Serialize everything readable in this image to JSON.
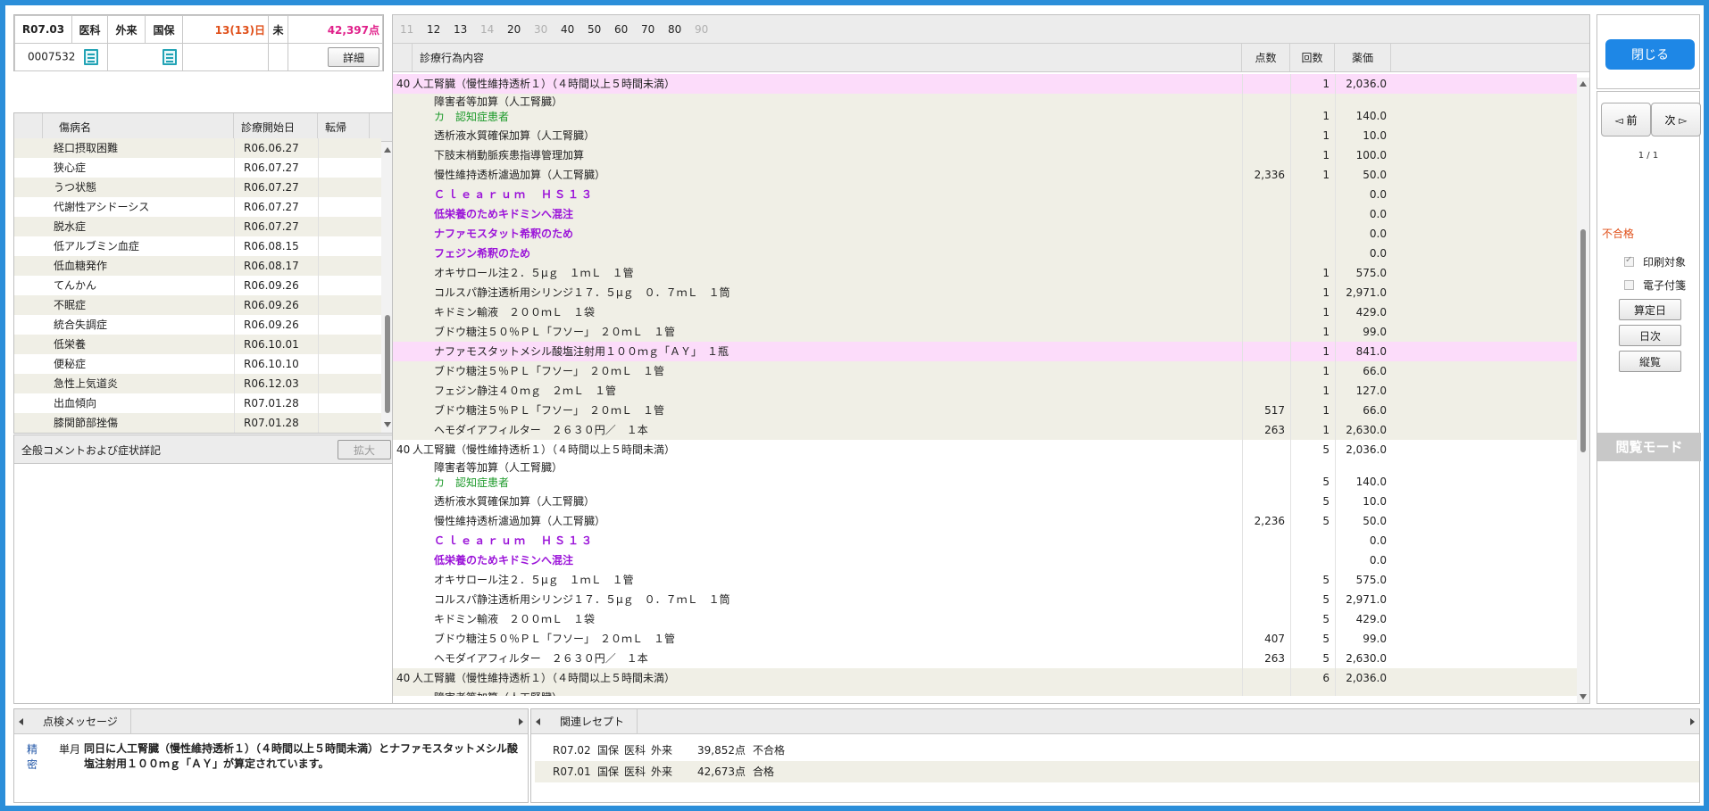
{
  "info": {
    "year_month": "R07.03",
    "dept": "医科",
    "io": "外来",
    "insurance": "国保",
    "days": "13(13)日",
    "status": "未",
    "points": "42,397点",
    "patient_id": "0007532",
    "detail_button": "詳細"
  },
  "disease": {
    "col_name": "傷病名",
    "col_start": "診療開始日",
    "col_outcome": "転帰",
    "rows": [
      {
        "name": "経口摂取困難",
        "date": "R06.06.27"
      },
      {
        "name": "狭心症",
        "date": "R06.07.27"
      },
      {
        "name": "うつ状態",
        "date": "R06.07.27"
      },
      {
        "name": "代謝性アシドーシス",
        "date": "R06.07.27"
      },
      {
        "name": "脱水症",
        "date": "R06.07.27"
      },
      {
        "name": "低アルブミン血症",
        "date": "R06.08.15"
      },
      {
        "name": "低血糖発作",
        "date": "R06.08.17"
      },
      {
        "name": "てんかん",
        "date": "R06.09.26"
      },
      {
        "name": "不眠症",
        "date": "R06.09.26"
      },
      {
        "name": "統合失調症",
        "date": "R06.09.26"
      },
      {
        "name": "低栄養",
        "date": "R06.10.01"
      },
      {
        "name": "便秘症",
        "date": "R06.10.10"
      },
      {
        "name": "急性上気道炎",
        "date": "R06.12.03"
      },
      {
        "name": "出血傾向",
        "date": "R07.01.28"
      },
      {
        "name": "膝関節部挫傷",
        "date": "R07.01.28"
      }
    ]
  },
  "comment": {
    "title": "全般コメントおよび症状詳記",
    "expand_button": "拡大"
  },
  "tabs": [
    {
      "label": "11",
      "dim": true
    },
    {
      "label": "12",
      "dim": false
    },
    {
      "label": "13",
      "dim": false
    },
    {
      "label": "14",
      "dim": true
    },
    {
      "label": "20",
      "dim": false
    },
    {
      "label": "30",
      "dim": true
    },
    {
      "label": "40",
      "dim": false
    },
    {
      "label": "50",
      "dim": false
    },
    {
      "label": "60",
      "dim": false
    },
    {
      "label": "70",
      "dim": false
    },
    {
      "label": "80",
      "dim": false
    },
    {
      "label": "90",
      "dim": true
    }
  ],
  "main": {
    "col_content": "診療行為内容",
    "col_points": "点数",
    "col_count": "回数",
    "col_price": "薬価",
    "rows": [
      {
        "k": "40",
        "name": "人工腎臓（慢性維持透析１）（４時間以上５時間未満）",
        "p": "",
        "c": "1",
        "y": "2,036.0",
        "bg": "pink"
      },
      {
        "k": "",
        "name": "障害者等加算（人工腎臓）",
        "name2": "カ　認知症患者",
        "p": "",
        "c": "1",
        "y": "140.0",
        "bg": "alt",
        "two": true
      },
      {
        "k": "",
        "name": "透析液水質確保加算（人工腎臓）",
        "p": "",
        "c": "1",
        "y": "10.0",
        "bg": "alt"
      },
      {
        "k": "",
        "name": "下肢末梢動脈疾患指導管理加算",
        "p": "",
        "c": "1",
        "y": "100.0",
        "bg": "alt"
      },
      {
        "k": "",
        "name": "慢性維持透析濾過加算（人工腎臓）",
        "p": "2,336",
        "c": "1",
        "y": "50.0",
        "bg": "alt"
      },
      {
        "k": "",
        "name": "Ｃｌｅａｒｕｍ　ＨＳ１３",
        "p": "",
        "c": "",
        "y": "0.0",
        "bg": "alt",
        "style": "purple-sp"
      },
      {
        "k": "",
        "name": "低栄養のためキドミンへ混注",
        "p": "",
        "c": "",
        "y": "0.0",
        "bg": "alt",
        "style": "purple"
      },
      {
        "k": "",
        "name": "ナファモスタット希釈のため",
        "p": "",
        "c": "",
        "y": "0.0",
        "bg": "alt",
        "style": "purple"
      },
      {
        "k": "",
        "name": "フェジン希釈のため",
        "p": "",
        "c": "",
        "y": "0.0",
        "bg": "alt",
        "style": "purple"
      },
      {
        "k": "",
        "name": "オキサロール注２．５μｇ　１ｍＬ　１管",
        "p": "",
        "c": "1",
        "y": "575.0",
        "bg": "alt"
      },
      {
        "k": "",
        "name": "コルスパ静注透析用シリンジ１７．５μｇ　０．７ｍＬ　１筒",
        "p": "",
        "c": "1",
        "y": "2,971.0",
        "bg": "alt"
      },
      {
        "k": "",
        "name": "キドミン輸液　２００ｍＬ　１袋",
        "p": "",
        "c": "1",
        "y": "429.0",
        "bg": "alt"
      },
      {
        "k": "",
        "name": "ブドウ糖注５０％ＰＬ「フソー」　２０ｍＬ　１管",
        "p": "",
        "c": "1",
        "y": "99.0",
        "bg": "alt"
      },
      {
        "k": "",
        "name": "ナファモスタットメシル酸塩注射用１００ｍｇ「ＡＹ」　１瓶",
        "p": "",
        "c": "1",
        "y": "841.0",
        "bg": "pink"
      },
      {
        "k": "",
        "name": "ブドウ糖注５％ＰＬ「フソー」　２０ｍＬ　１管",
        "p": "",
        "c": "1",
        "y": "66.0",
        "bg": "alt"
      },
      {
        "k": "",
        "name": "フェジン静注４０ｍｇ　２ｍＬ　１管",
        "p": "",
        "c": "1",
        "y": "127.0",
        "bg": "alt"
      },
      {
        "k": "",
        "name": "ブドウ糖注５％ＰＬ「フソー」　２０ｍＬ　１管",
        "p": "517",
        "c": "1",
        "y": "66.0",
        "bg": "alt"
      },
      {
        "k": "",
        "name": "ヘモダイアフィルター　２６３０円／　１本",
        "p": "263",
        "c": "1",
        "y": "2,630.0",
        "bg": "alt"
      },
      {
        "k": "40",
        "name": "人工腎臓（慢性維持透析１）（４時間以上５時間未満）",
        "p": "",
        "c": "5",
        "y": "2,036.0",
        "bg": "white"
      },
      {
        "k": "",
        "name": "障害者等加算（人工腎臓）",
        "name2": "カ　認知症患者",
        "p": "",
        "c": "5",
        "y": "140.0",
        "bg": "white",
        "two": true
      },
      {
        "k": "",
        "name": "透析液水質確保加算（人工腎臓）",
        "p": "",
        "c": "5",
        "y": "10.0",
        "bg": "white"
      },
      {
        "k": "",
        "name": "慢性維持透析濾過加算（人工腎臓）",
        "p": "2,236",
        "c": "5",
        "y": "50.0",
        "bg": "white"
      },
      {
        "k": "",
        "name": "Ｃｌｅａｒｕｍ　ＨＳ１３",
        "p": "",
        "c": "",
        "y": "0.0",
        "bg": "white",
        "style": "purple-sp"
      },
      {
        "k": "",
        "name": "低栄養のためキドミンへ混注",
        "p": "",
        "c": "",
        "y": "0.0",
        "bg": "white",
        "style": "purple"
      },
      {
        "k": "",
        "name": "オキサロール注２．５μｇ　１ｍＬ　１管",
        "p": "",
        "c": "5",
        "y": "575.0",
        "bg": "white"
      },
      {
        "k": "",
        "name": "コルスパ静注透析用シリンジ１７．５μｇ　０．７ｍＬ　１筒",
        "p": "",
        "c": "5",
        "y": "2,971.0",
        "bg": "white"
      },
      {
        "k": "",
        "name": "キドミン輸液　２００ｍＬ　１袋",
        "p": "",
        "c": "5",
        "y": "429.0",
        "bg": "white"
      },
      {
        "k": "",
        "name": "ブドウ糖注５０％ＰＬ「フソー」　２０ｍＬ　１管",
        "p": "407",
        "c": "5",
        "y": "99.0",
        "bg": "white"
      },
      {
        "k": "",
        "name": "ヘモダイアフィルター　２６３０円／　１本",
        "p": "263",
        "c": "5",
        "y": "2,630.0",
        "bg": "white"
      },
      {
        "k": "40",
        "name": "人工腎臓（慢性維持透析１）（４時間以上５時間未満）",
        "p": "",
        "c": "6",
        "y": "2,036.0",
        "bg": "alt"
      },
      {
        "k": "",
        "name": "障害者等加算（人工腎臓）",
        "p": "",
        "c": "",
        "y": "",
        "bg": "alt"
      }
    ]
  },
  "right": {
    "close_button": "閉じる",
    "prev_button": "前",
    "next_button": "次",
    "page": "1 / 1",
    "fail_label": "不合格",
    "print_target": "印刷対象",
    "e_attach": "電子付箋",
    "calc_day_button": "算定日",
    "daily_button": "日次",
    "vertical_button": "縦覧",
    "mode_label": "閲覧モード"
  },
  "check_msg": {
    "tab": "点検メッセージ",
    "level": "精密",
    "period": "単月",
    "text": "同日に人工腎臓（慢性維持透析１）（４時間以上５時間未満）とナファモスタットメシル酸塩注射用１００ｍｇ「ＡＹ」が算定されています。"
  },
  "related": {
    "tab": "関連レセプト",
    "rows": [
      {
        "ym": "R07.02",
        "ins": "国保",
        "dept": "医科",
        "io": "外来",
        "pts": "39,852点",
        "result": "不合格"
      },
      {
        "ym": "R07.01",
        "ins": "国保",
        "dept": "医科",
        "io": "外来",
        "pts": "42,673点",
        "result": "合格"
      }
    ]
  }
}
